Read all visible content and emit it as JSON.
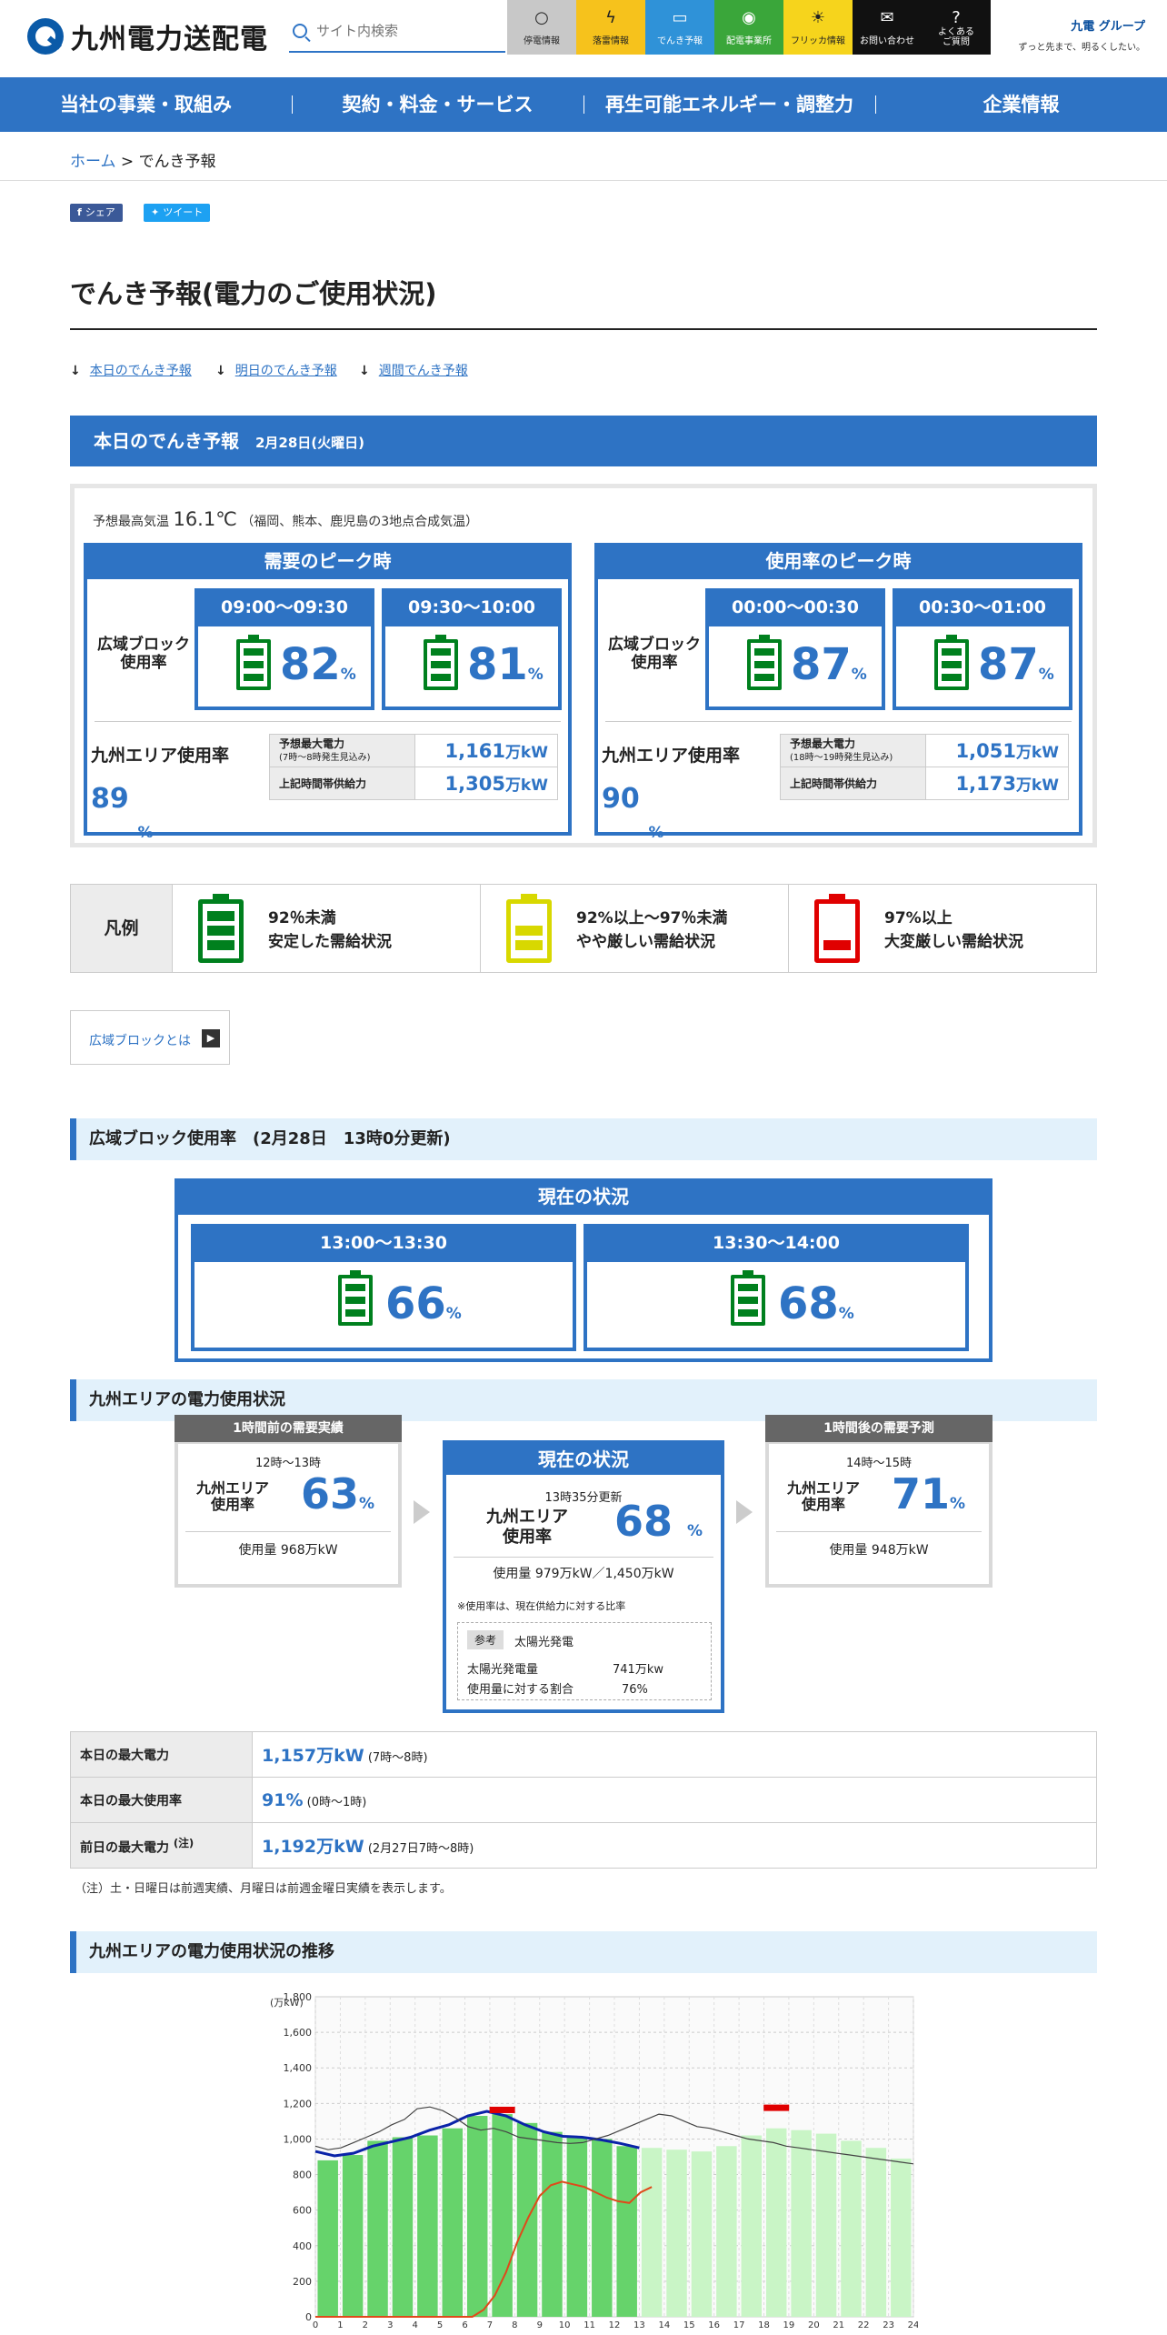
{
  "header": {
    "logo_text": "九州電力送配電",
    "search_placeholder": "サイト内検索",
    "quick": [
      {
        "label": "停電情報",
        "icon": "bulb-icon",
        "color": "#c8c8c8",
        "text": "#222"
      },
      {
        "label": "落雷情報",
        "icon": "lightning-icon",
        "color": "#f6c21c",
        "text": "#222"
      },
      {
        "label": "でんき予報",
        "icon": "battery-icon",
        "color": "#2f92d8",
        "text": "#fff"
      },
      {
        "label": "配電事業所",
        "icon": "pin-icon",
        "color": "#3aa63a",
        "text": "#fff"
      },
      {
        "label": "フリッカ情報",
        "icon": "flicker-icon",
        "color": "#f6d41c",
        "text": "#222"
      },
      {
        "label": "お問い合わせ",
        "icon": "mail-icon",
        "color": "#111",
        "text": "#fff"
      },
      {
        "label": "よくある\nご質問",
        "icon": "question-icon",
        "color": "#111",
        "text": "#fff"
      }
    ],
    "group_logo": "九電 グループ",
    "group_tagline": "ずっと先まで、明るくしたい。"
  },
  "nav": [
    "当社の事業・取組み",
    "契約・料金・サービス",
    "再生可能エネルギー・調整力",
    "企業情報"
  ],
  "breadcrumb": {
    "home": "ホーム",
    "sep": " > ",
    "current": "でんき予報"
  },
  "share": {
    "fb": "シェア",
    "tw": "ツイート"
  },
  "page_title": "でんき予報(電力のご使用状況)",
  "anchors": [
    "本日のでんき予報",
    "明日のでんき予報",
    "週間でんき予報"
  ],
  "today": {
    "title": "本日のでんき予報",
    "date": "2月28日(火曜日)",
    "temp_label": "予想最高気温",
    "temp_value": "16.1℃",
    "temp_note": "（福岡、熊本、鹿児島の3地点合成気温）",
    "demand_peak": {
      "title": "需要のピーク時",
      "block_label": "広域ブロック\n使用率",
      "slots": [
        {
          "time": "09:00～09:30",
          "value": "82",
          "unit": "%"
        },
        {
          "time": "09:30～10:00",
          "value": "81",
          "unit": "%"
        }
      ],
      "area_label": "九州エリア使用率",
      "area_value": "89",
      "area_unit": "%",
      "rows": [
        {
          "k": "予想最大電力",
          "sub": "(7時～8時発生見込み)",
          "v": "1,161",
          "u": "万kW"
        },
        {
          "k": "上記時間帯供給力",
          "sub": "",
          "v": "1,305",
          "u": "万kW"
        }
      ]
    },
    "usage_peak": {
      "title": "使用率のピーク時",
      "block_label": "広域ブロック\n使用率",
      "slots": [
        {
          "time": "00:00～00:30",
          "value": "87",
          "unit": "%"
        },
        {
          "time": "00:30～01:00",
          "value": "87",
          "unit": "%"
        }
      ],
      "area_label": "九州エリア使用率",
      "area_value": "90",
      "area_unit": "%",
      "rows": [
        {
          "k": "予想最大電力",
          "sub": "(18時～19時発生見込み)",
          "v": "1,051",
          "u": "万kW"
        },
        {
          "k": "上記時間帯供給力",
          "sub": "",
          "v": "1,173",
          "u": "万kW"
        }
      ]
    }
  },
  "legend": {
    "title": "凡例",
    "items": [
      {
        "l1": "92％未満",
        "l2": "安定した需給状況",
        "color": "#00801e",
        "bars": 3
      },
      {
        "l1": "92%以上～97％未満",
        "l2": "やや厳しい需給状況",
        "color": "#d8d800",
        "bars": 2
      },
      {
        "l1": "97%以上",
        "l2": "大変厳しい需給状況",
        "color": "#e00000",
        "bars": 1
      }
    ]
  },
  "kouiki_link": "広域ブロックとは",
  "block_section": {
    "title": "広域ブロック使用率　(2月28日　13時0分更新)",
    "current_title": "現在の状況",
    "slots": [
      {
        "time": "13:00～13:30",
        "value": "66",
        "unit": "%"
      },
      {
        "time": "13:30～14:00",
        "value": "68",
        "unit": "%"
      }
    ]
  },
  "area_section": {
    "title": "九州エリアの電力使用状況",
    "prev": {
      "head": "1時間前の需要実績",
      "time": "12時～13時",
      "label": "九州エリア\n使用率",
      "value": "63",
      "unit": "%",
      "usage": "使用量 968万kW"
    },
    "now": {
      "head": "現在の状況",
      "time": "13時35分更新",
      "label": "九州エリア\n使用率",
      "value": "68",
      "unit": "%",
      "usage": "使用量 979万kW／1,450万kW",
      "note": "※使用率は、現在供給力に対する比率",
      "ref_tag": "参考",
      "ref_name": "太陽光発電",
      "ref_rows": [
        {
          "k": "太陽光発電量",
          "v": "741万kw"
        },
        {
          "k": "使用量に対する割合",
          "v": "76%"
        }
      ]
    },
    "next": {
      "head": "1時間後の需要予測",
      "time": "14時～15時",
      "label": "九州エリア\n使用率",
      "value": "71",
      "unit": "%",
      "usage": "使用量 948万kW"
    }
  },
  "max_table": [
    {
      "k": "本日の最大電力",
      "sup": "",
      "v": "1,157万kW",
      "sub": "(7時～8時)"
    },
    {
      "k": "本日の最大使用率",
      "sup": "",
      "v": "91%",
      "sub": "(0時～1時)"
    },
    {
      "k": "前日の最大電力",
      "sup": "(注)",
      "v": "1,192万kW",
      "sub": "(2月27日7時～8時)"
    }
  ],
  "max_note": "（注）土・日曜日は前週実績、月曜日は前週金曜日実績を表示します。",
  "trend_title": "九州エリアの電力使用状況の推移",
  "chart_data": {
    "type": "bar",
    "ylabel": "(万kW)",
    "ylim": [
      0,
      1800
    ],
    "yticks": [
      0,
      200,
      400,
      600,
      800,
      1000,
      1200,
      1400,
      1600,
      1800
    ],
    "categories": [
      0,
      1,
      2,
      3,
      4,
      5,
      6,
      7,
      8,
      9,
      10,
      11,
      12,
      13,
      14,
      15,
      16,
      17,
      18,
      19,
      20,
      21,
      22,
      23,
      24
    ],
    "actual_bars": [
      880,
      910,
      990,
      1010,
      1020,
      1060,
      1130,
      1140,
      1090,
      1040,
      1010,
      1000,
      960
    ],
    "forecast_bars": [
      950,
      940,
      930,
      960,
      1020,
      1060,
      1050,
      1030,
      990,
      950,
      890
    ],
    "demand_line": [
      930,
      905,
      920,
      960,
      985,
      1010,
      1050,
      1080,
      1130,
      1155,
      1130,
      1080,
      1040,
      1015,
      1010,
      995,
      975,
      950
    ],
    "supply_line": [
      960,
      940,
      950,
      980,
      1010,
      1040,
      1080,
      1110,
      1170,
      1180,
      1160,
      1120,
      1070,
      1050,
      1060,
      1040,
      1010,
      1000,
      990,
      980,
      975,
      980,
      1000,
      1020,
      1050,
      1080,
      1110,
      1140,
      1130,
      1100,
      1070,
      1060,
      1040,
      1020,
      1000,
      990,
      980,
      960,
      950,
      940,
      930,
      920,
      910,
      900,
      890,
      880,
      870,
      860
    ],
    "solar_line": [
      0,
      0,
      0,
      0,
      0,
      0,
      0,
      0,
      0,
      0,
      0,
      0,
      0,
      0,
      0,
      40,
      120,
      250,
      420,
      560,
      680,
      740,
      760,
      745,
      730,
      700,
      670,
      650,
      640,
      700,
      730
    ],
    "peak_marks": [
      {
        "x": 7.5,
        "value": 1161
      },
      {
        "x": 18.5,
        "value": 1173
      }
    ]
  }
}
